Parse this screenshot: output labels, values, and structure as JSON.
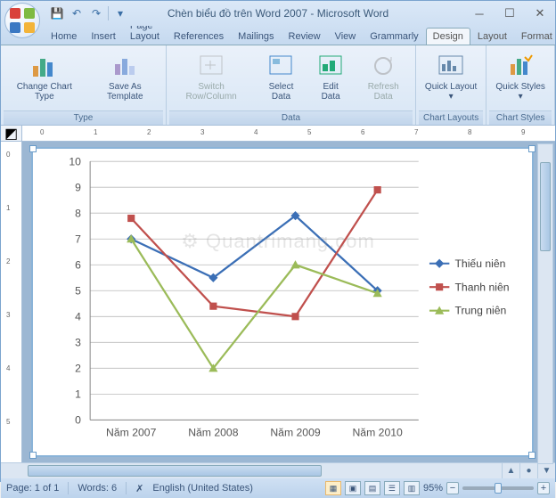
{
  "title": "Chèn biểu đồ trên Word 2007 - Microsoft Word",
  "qat": {
    "save": "💾",
    "undo": "↶",
    "redo": "↷"
  },
  "tabs": [
    "Home",
    "Insert",
    "Page Layout",
    "References",
    "Mailings",
    "Review",
    "View",
    "Grammarly",
    "Design",
    "Layout",
    "Format"
  ],
  "active_tab": "Design",
  "ribbon": {
    "type": {
      "label": "Type",
      "change_chart": "Change Chart Type",
      "save_template": "Save As Template"
    },
    "data": {
      "label": "Data",
      "switch": "Switch Row/Column",
      "select": "Select Data",
      "edit": "Edit Data",
      "refresh": "Refresh Data"
    },
    "layouts": {
      "label": "Chart Layouts",
      "quick_layout": "Quick Layout ▾"
    },
    "styles": {
      "label": "Chart Styles",
      "quick_styles": "Quick Styles ▾"
    }
  },
  "chart_data": {
    "type": "line",
    "categories": [
      "Năm 2007",
      "Năm 2008",
      "Năm 2009",
      "Năm 2010"
    ],
    "series": [
      {
        "name": "Thiếu niên",
        "color": "#3b6fb6",
        "values": [
          7.0,
          5.5,
          7.9,
          5.0
        ]
      },
      {
        "name": "Thanh niên",
        "color": "#c0504d",
        "values": [
          7.8,
          4.4,
          4.0,
          8.9
        ]
      },
      {
        "name": "Trung niên",
        "color": "#9bbb59",
        "values": [
          7.0,
          2.0,
          6.0,
          4.9
        ]
      }
    ],
    "ylim": [
      0,
      10
    ],
    "ytick": 1
  },
  "status": {
    "page": "Page: 1 of 1",
    "words": "Words: 6",
    "language": "English (United States)",
    "zoom": "95%"
  },
  "watermark": "Quantrimang.com"
}
